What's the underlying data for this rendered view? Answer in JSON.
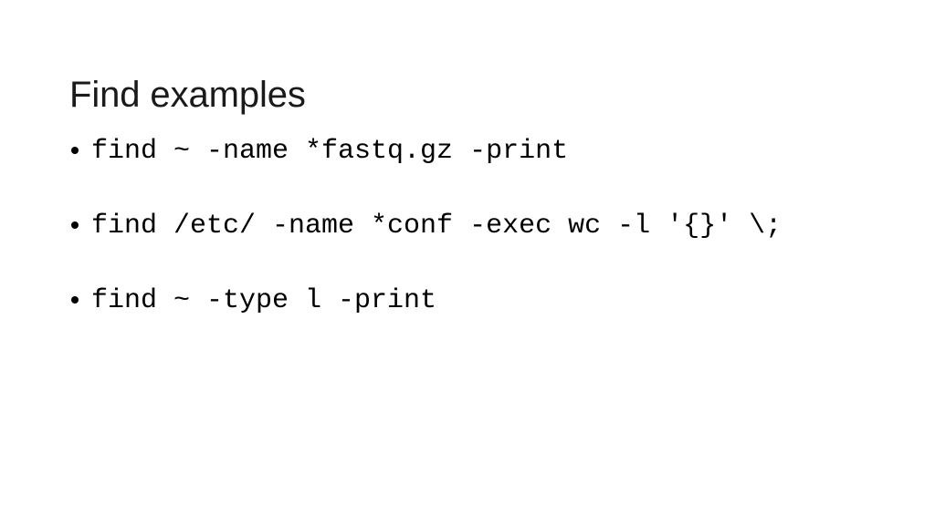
{
  "slide": {
    "title": "Find examples",
    "background_color": "#ffffff",
    "text_color": "#000000",
    "title_color": "#1a1a1a",
    "bullet_marker_icon": "bullet-dot-icon",
    "bullets": [
      {
        "text": "find ~ -name *fastq.gz -print"
      },
      {
        "text": "find /etc/ -name *conf -exec wc -l '{}' \\;"
      },
      {
        "text": "find ~ -type l -print"
      }
    ]
  }
}
